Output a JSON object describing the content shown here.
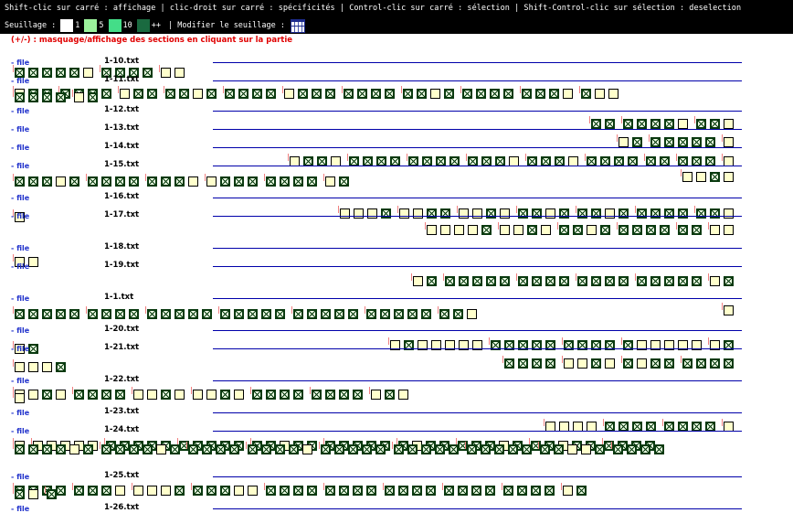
{
  "help_text": "Shift-clic sur carré : affichage | clic-droit sur carré : spécificités | Control-clic sur carré : sélection | Shift-Control-clic sur sélection : deselection",
  "threshold": {
    "label": "Seuillage :",
    "levels": [
      {
        "label": "1",
        "color": "#ffffff"
      },
      {
        "label": "5",
        "color": "#9cf29c"
      },
      {
        "label": "10",
        "color": "#44dd88"
      },
      {
        "label": "++",
        "color": "#1a6a40"
      }
    ],
    "modify_label": "| Modifier le seuillage :",
    "icon": "grid-table-icon"
  },
  "instructions": "(+/-) : masquage/affichage des sections en cliquant sur la partie",
  "file_label": "- file",
  "files": [
    {
      "name": "1-10.txt",
      "squares": "[xxxxx.][xxxx][..]",
      "cont": ""
    },
    {
      "name": "1-11.txt",
      "squares": "[.xx][xxxx][.xx][xx.x][xxxx][.xxx][xxxx][xx.x][xxxx][xxx.][x..]",
      "cont": "[xxxx][.x]"
    },
    {
      "name": "1-12.txt",
      "squares": "[xx][xxxx.][xx.]",
      "cont": ""
    },
    {
      "name": "1-13.txt",
      "squares": "[.x][xxxxx][.]",
      "cont": ""
    },
    {
      "name": "1-14.txt",
      "squares": "[.xx.][xxxx][xxxx][xxx.][xxx.][xxxx][xx][xxx][.]",
      "cont": ""
    },
    {
      "name": "1-15.txt",
      "squares": "[..x.]",
      "cont": "[xxx.x][xxxx][xxx.][.xxx][xxxx][.x]"
    },
    {
      "name": "1-16.txt",
      "squares": "[...x][..xx][..x.][xx.x][xx.x][xxxx][xx.]",
      "cont": "[.]"
    },
    {
      "name": "1-17.txt",
      "squares": "[....x][..x.][xx.x][xxxx][xx][..]",
      "cont": ""
    },
    {
      "name": "1-18.txt",
      "squares": "[..]",
      "cont": ""
    },
    {
      "name": "1-19.txt",
      "squares": "[.x][xxxxx][xxxx][xxxx][xxxxx][.x]",
      "cont": ""
    },
    {
      "name": "1-1.txt",
      "squares": "[.]",
      "cont": "[xxxxx][xxxx][xxxxx][xxxxx][xxxxx][xxxxx][xx.]"
    },
    {
      "name": "1-20.txt",
      "squares": "[.x.....][xxxxx][xxxx][x.....][.x]",
      "cont": "[.x]"
    },
    {
      "name": "1-21.txt",
      "squares": "[xxxx][..x.][x.xx][xxxx]",
      "cont": "[...x]"
    },
    {
      "name": "1-22.txt",
      "squares": "[..x.][xxxx][..x.][..x.][xxxx][xxxx][.x.]",
      "cont": "[.]"
    },
    {
      "name": "1-23.txt",
      "squares": "[....][xxxx][xxxx][.]",
      "cont": ""
    },
    {
      "name": "1-24.txt",
      "squares": "[.][.....][xxxxx][xxxxx][xx.xx][xxxxx][x.xx][xxx.x][xx.xx][xxxx]",
      "cont": "[xxxx.x][xxxx.x][xxxx][xxxx.][xxxxx][xxxxx][xxxxx][xx..x][xxxx]"
    },
    {
      "name": "1-25.txt",
      "squares": "[xxxx][xxx.][...x][xxx..][xxxx][xxxx][xxxx][xxxx][xxxx][.x]",
      "cont": "[x.][x]"
    },
    {
      "name": "1-26.txt",
      "squares": "",
      "cont": ""
    }
  ]
}
